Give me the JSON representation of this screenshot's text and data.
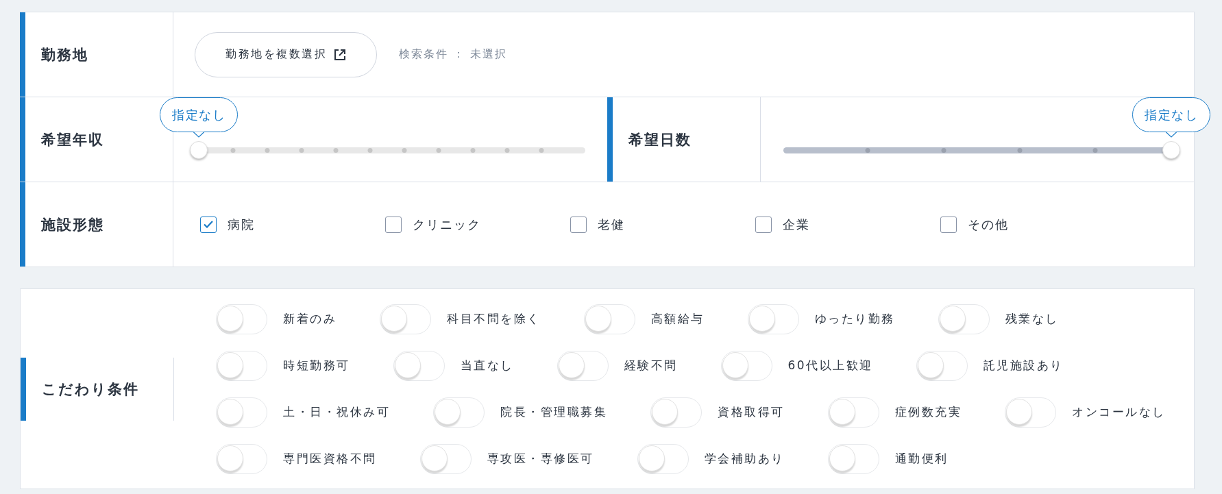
{
  "location": {
    "label": "勤務地",
    "button": "勤務地を複数選択",
    "condition": "検索条件 ： 未選択"
  },
  "sliders": [
    {
      "label": "希望年収",
      "tooltip": "指定なし",
      "level": 0
    },
    {
      "label": "希望日数",
      "tooltip": "指定なし",
      "level": 1
    }
  ],
  "facility": {
    "label": "施設形態",
    "options": [
      {
        "label": "病院",
        "checked": true
      },
      {
        "label": "クリニック",
        "checked": false
      },
      {
        "label": "老健",
        "checked": false
      },
      {
        "label": "企業",
        "checked": false
      },
      {
        "label": "その他",
        "checked": false
      }
    ]
  },
  "preferences": {
    "label": "こだわり条件",
    "rows": [
      [
        {
          "label": "新着のみ",
          "on": false
        },
        {
          "label": "科目不問を除く",
          "on": false
        },
        {
          "label": "高額給与",
          "on": false
        },
        {
          "label": "ゆったり勤務",
          "on": false
        },
        {
          "label": "残業なし",
          "on": false
        }
      ],
      [
        {
          "label": "時短勤務可",
          "on": false
        },
        {
          "label": "当直なし",
          "on": false
        },
        {
          "label": "経験不問",
          "on": false
        },
        {
          "label": "60代以上歓迎",
          "on": false
        },
        {
          "label": "託児施設あり",
          "on": false
        }
      ],
      [
        {
          "label": "土・日・祝休み可",
          "on": false
        },
        {
          "label": "院長・管理職募集",
          "on": false
        },
        {
          "label": "資格取得可",
          "on": false
        },
        {
          "label": "症例数充実",
          "on": false
        },
        {
          "label": "オンコールなし",
          "on": false
        }
      ],
      [
        {
          "label": "専門医資格不問",
          "on": false
        },
        {
          "label": "専攻医・専修医可",
          "on": false
        },
        {
          "label": "学会補助あり",
          "on": false
        },
        {
          "label": "通勤便利",
          "on": false
        }
      ]
    ]
  }
}
